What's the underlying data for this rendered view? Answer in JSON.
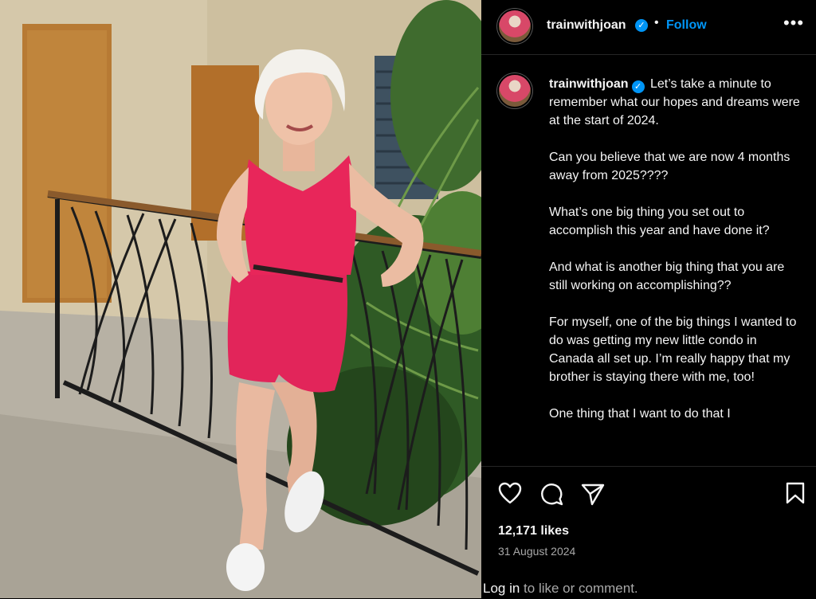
{
  "post": {
    "username": "trainwithjoan",
    "verified_icon": "verified-badge-icon",
    "follow_label": "Follow",
    "more_icon": "more-options-icon",
    "more_glyph": "•••",
    "separator": "•"
  },
  "caption": {
    "username": "trainwithjoan",
    "text": " Let’s take a minute to remember what our hopes and dreams were at the start of 2024.\n\nCan you believe that we are now 4 months away from 2025????\n\nWhat’s one big thing you set out to accomplish this year and have done it?\n\nAnd what is another big thing that you are still working on accomplishing??\n\nFor myself, one of the big things I wanted to do was getting my new little condo in Canada all set up. I’m really happy that my brother is staying there with me, too!\n\nOne thing that I want to do that I"
  },
  "actions": {
    "like_icon": "heart-icon",
    "comment_icon": "comment-icon",
    "share_icon": "share-icon",
    "save_icon": "bookmark-icon"
  },
  "stats": {
    "likes": "12,171 likes",
    "date": "31 August 2024"
  },
  "footer": {
    "login_link": "Log in",
    "login_rest": " to like or comment."
  },
  "colors": {
    "background": "#000000",
    "accent": "#0095f6",
    "text": "#f5f5f5",
    "secondary_text": "#a8a8a8",
    "outfit": "#e8265a"
  }
}
